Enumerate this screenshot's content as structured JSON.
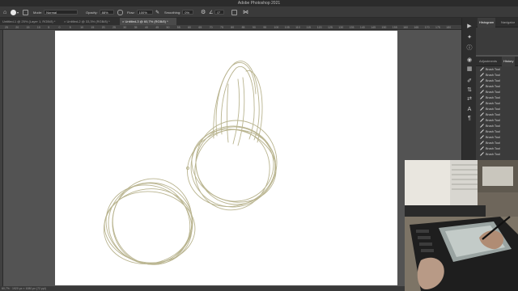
{
  "app": {
    "title": "Adobe Photoshop 2021"
  },
  "options_bar": {
    "mode_label": "Mode:",
    "mode_value": "Normal",
    "opacity_label": "Opacity:",
    "opacity_value": "88%",
    "flow_label": "Flow:",
    "flow_value": "100%",
    "smoothing_label": "Smoothing:",
    "smoothing_value": "0%",
    "angle_value": "0°"
  },
  "tabs": [
    {
      "label": "Untitled-1 @ 25% (Layer 1, RGB/8) *"
    },
    {
      "label": "Untitled-2 @ 33,3% (RGB/8) *"
    },
    {
      "label": "Untitled-3 @ 60,7% (RGB/8) *"
    }
  ],
  "ruler": {
    "ticks": [
      "25",
      "20",
      "15",
      "10",
      "5",
      "0",
      "5",
      "10",
      "15",
      "20",
      "25",
      "30",
      "35",
      "40",
      "45",
      "50",
      "55",
      "60",
      "65",
      "70",
      "75",
      "80",
      "85",
      "90",
      "95",
      "100",
      "105",
      "110",
      "115",
      "120",
      "125",
      "130",
      "135",
      "140",
      "145",
      "150",
      "155",
      "160",
      "165",
      "170",
      "175",
      "180"
    ]
  },
  "status": {
    "text": "60,7% · 1920 px × 1080 px (72 ppi)"
  },
  "panels": {
    "top_tabs": [
      "Histogram",
      "Navigator"
    ],
    "history_tabs": [
      "Adjustments",
      "History"
    ],
    "history_items": [
      "Brush Tool",
      "Brush Tool",
      "Brush Tool",
      "Brush Tool",
      "Brush Tool",
      "Brush Tool",
      "Brush Tool",
      "Brush Tool",
      "Brush Tool",
      "Brush Tool",
      "Brush Tool",
      "Brush Tool",
      "Brush Tool",
      "Brush Tool",
      "Brush Tool",
      "Brush Tool"
    ]
  },
  "colors": {
    "sketch_stroke": "#b9b48f",
    "canvas_bg": "#ffffff",
    "workspace": "#535353"
  }
}
